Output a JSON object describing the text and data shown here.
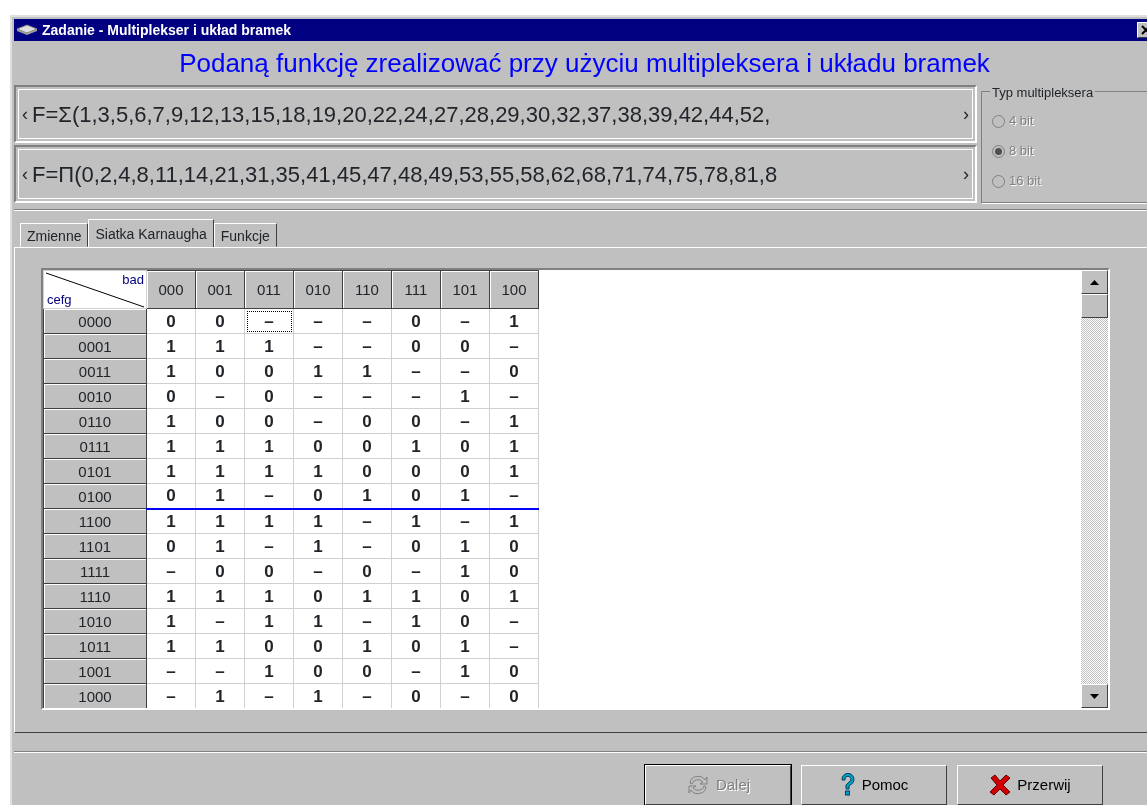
{
  "window": {
    "title": "Zadanie - Multiplekser i układ bramek"
  },
  "heading": "Podaną funkcję zrealizować przy użyciu multipleksera i układu bramek",
  "formulas": [
    {
      "text": "F=Σ(1,3,5,6,7,9,12,13,15,18,19,20,22,24,27,28,29,30,32,37,38,39,42,44,52,",
      "left": "‹",
      "right": "›"
    },
    {
      "text": "F=Π(0,2,4,8,11,14,21,31,35,41,45,47,48,49,53,55,58,62,68,71,74,75,78,81,8",
      "left": "‹",
      "right": "›"
    }
  ],
  "mux_type": {
    "label": "Typ multipleksera",
    "disabled": true,
    "options": [
      {
        "label": "4 bit",
        "selected": false
      },
      {
        "label": "8 bit",
        "selected": true
      },
      {
        "label": "16 bit",
        "selected": false
      }
    ]
  },
  "tabs": [
    {
      "label": "Zmienne",
      "selected": false
    },
    {
      "label": "Siatka Karnaugha",
      "selected": true
    },
    {
      "label": "Funkcje",
      "selected": false
    }
  ],
  "grid": {
    "corner_top": "bad",
    "corner_bottom": "cefg",
    "columns": [
      "000",
      "001",
      "011",
      "010",
      "110",
      "111",
      "101",
      "100"
    ],
    "rows": [
      {
        "label": "0000",
        "cells": [
          "0",
          "0",
          "–",
          "–",
          "–",
          "0",
          "–",
          "1"
        ],
        "focused": [
          false,
          false,
          true,
          false,
          false,
          false,
          false,
          false
        ],
        "axis_below": false
      },
      {
        "label": "0001",
        "cells": [
          "1",
          "1",
          "1",
          "–",
          "–",
          "0",
          "0",
          "–"
        ],
        "axis_below": false
      },
      {
        "label": "0011",
        "cells": [
          "1",
          "0",
          "0",
          "1",
          "1",
          "–",
          "–",
          "0"
        ],
        "axis_below": false
      },
      {
        "label": "0010",
        "cells": [
          "0",
          "–",
          "0",
          "–",
          "–",
          "–",
          "1",
          "–"
        ],
        "axis_below": false
      },
      {
        "label": "0110",
        "cells": [
          "1",
          "0",
          "0",
          "–",
          "0",
          "0",
          "–",
          "1"
        ],
        "axis_below": false
      },
      {
        "label": "0111",
        "cells": [
          "1",
          "1",
          "1",
          "0",
          "0",
          "1",
          "0",
          "1"
        ],
        "axis_below": false
      },
      {
        "label": "0101",
        "cells": [
          "1",
          "1",
          "1",
          "1",
          "0",
          "0",
          "0",
          "1"
        ],
        "axis_below": false
      },
      {
        "label": "0100",
        "cells": [
          "0",
          "1",
          "–",
          "0",
          "1",
          "0",
          "1",
          "–"
        ],
        "axis_below": true
      },
      {
        "label": "1100",
        "cells": [
          "1",
          "1",
          "1",
          "1",
          "–",
          "1",
          "–",
          "1"
        ],
        "axis_below": false
      },
      {
        "label": "1101",
        "cells": [
          "0",
          "1",
          "–",
          "1",
          "–",
          "0",
          "1",
          "0"
        ],
        "axis_below": false
      },
      {
        "label": "1111",
        "cells": [
          "–",
          "0",
          "0",
          "–",
          "0",
          "–",
          "1",
          "0"
        ],
        "axis_below": false
      },
      {
        "label": "1110",
        "cells": [
          "1",
          "1",
          "1",
          "0",
          "1",
          "1",
          "0",
          "1"
        ],
        "axis_below": false
      },
      {
        "label": "1010",
        "cells": [
          "1",
          "–",
          "1",
          "1",
          "–",
          "1",
          "0",
          "–"
        ],
        "axis_below": false
      },
      {
        "label": "1011",
        "cells": [
          "1",
          "1",
          "0",
          "0",
          "1",
          "0",
          "1",
          "–"
        ],
        "axis_below": false
      },
      {
        "label": "1001",
        "cells": [
          "–",
          "–",
          "1",
          "0",
          "0",
          "–",
          "1",
          "0"
        ],
        "axis_below": false
      },
      {
        "label": "1000",
        "cells": [
          "–",
          "1",
          "–",
          "1",
          "–",
          "0",
          "–",
          "0"
        ],
        "axis_below": false
      }
    ]
  },
  "buttons": [
    {
      "kind": "next",
      "label": "Dalej",
      "disabled": true
    },
    {
      "kind": "help",
      "label": "Pomoc",
      "disabled": false
    },
    {
      "kind": "abort",
      "label": "Przerwij",
      "disabled": false
    }
  ]
}
